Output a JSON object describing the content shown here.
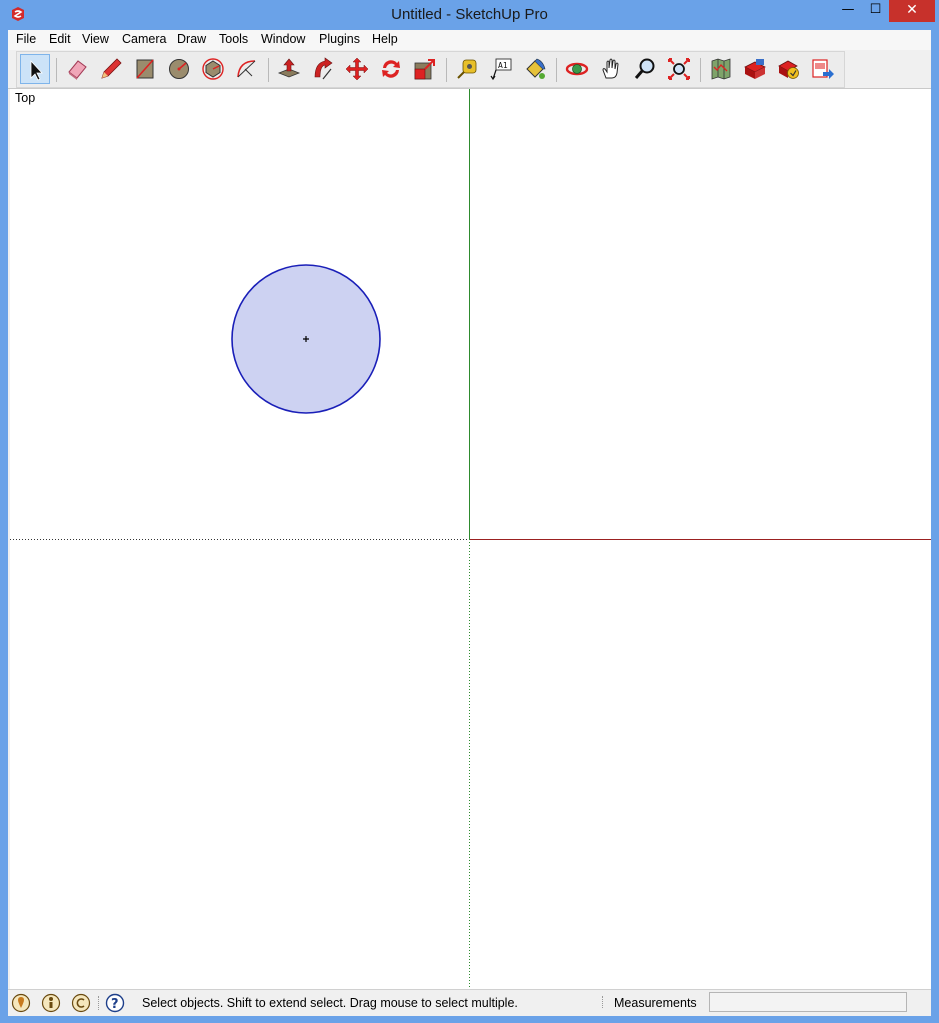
{
  "window": {
    "title": "Untitled - SketchUp Pro",
    "controls": {
      "minimize": "—",
      "maximize": "☐",
      "close": "✕"
    }
  },
  "menu": {
    "items": [
      "File",
      "Edit",
      "View",
      "Camera",
      "Draw",
      "Tools",
      "Window",
      "Plugins",
      "Help"
    ]
  },
  "toolbar": {
    "tools": [
      "select",
      "eraser",
      "line",
      "rectangle",
      "circle",
      "polygon",
      "arc",
      "push-pull",
      "follow-me",
      "move",
      "rotate",
      "scale",
      "tape-measure",
      "text",
      "paint-bucket",
      "orbit",
      "pan",
      "zoom",
      "zoom-extents",
      "get-models",
      "share-model",
      "share-component",
      "send-to-layout"
    ],
    "active_tool": "select"
  },
  "viewport": {
    "view_label": "Top",
    "circle_fill": "#cdd2f2",
    "circle_stroke": "#1a1fb8",
    "green_axis": "#2e8b2e",
    "red_axis": "#9b2121"
  },
  "statusbar": {
    "instruction": "Select objects. Shift to extend select. Drag mouse to select multiple.",
    "measurements_label": "Measurements",
    "measurements_value": ""
  },
  "colors": {
    "titlebar": "#6aa2e8",
    "close_button": "#c7312b",
    "active_tool_bg": "#cce3f8"
  }
}
